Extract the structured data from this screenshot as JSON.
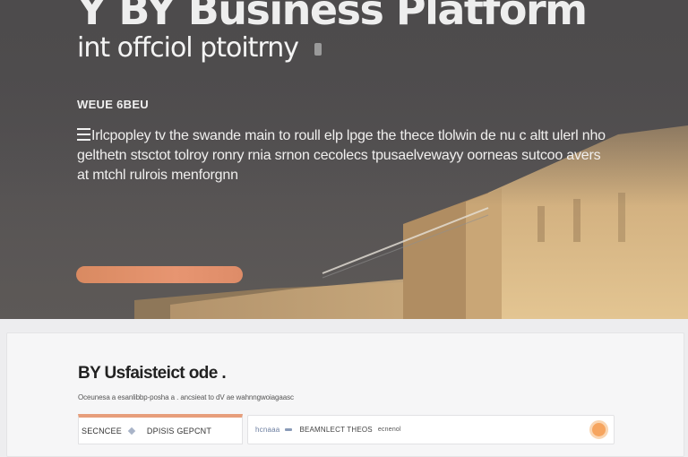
{
  "hero": {
    "title": "Y BY Business Platform",
    "subtitle": "int offciol ptoitrny",
    "eyebrow": "WEUE  6BEU",
    "description": "Irlcpopley tv the swande main to roull elp lpge the thece tlolwin de nu c altt ulerl nho gelthetn stsctot tolroy ronry rnia srnon cecolecs tpusaelvewayy oorneas sutcoo avers at mtchl rulrois menforgnn",
    "cta_label": "",
    "colors": {
      "accent": "#e58f6b",
      "background": "#4f4d4e"
    }
  },
  "panel": {
    "title": "BY Usfaisteict ode .",
    "subtitle": "Oceunesa a esanlibbp-posha a . ancsieat  to dV ae wahnngwoiagaasc",
    "tab_left": {
      "label_1": "SECNCEE",
      "icon": "diamond-icon",
      "label_2": "DPISIS GEPCNT"
    },
    "tab_right": {
      "label_1": "hcnaaa",
      "icon": "dash-icon",
      "label_2": "BEAMNLECT  THEOS",
      "label_3": "ecnenol",
      "action_icon": "orange-circle-icon"
    }
  }
}
